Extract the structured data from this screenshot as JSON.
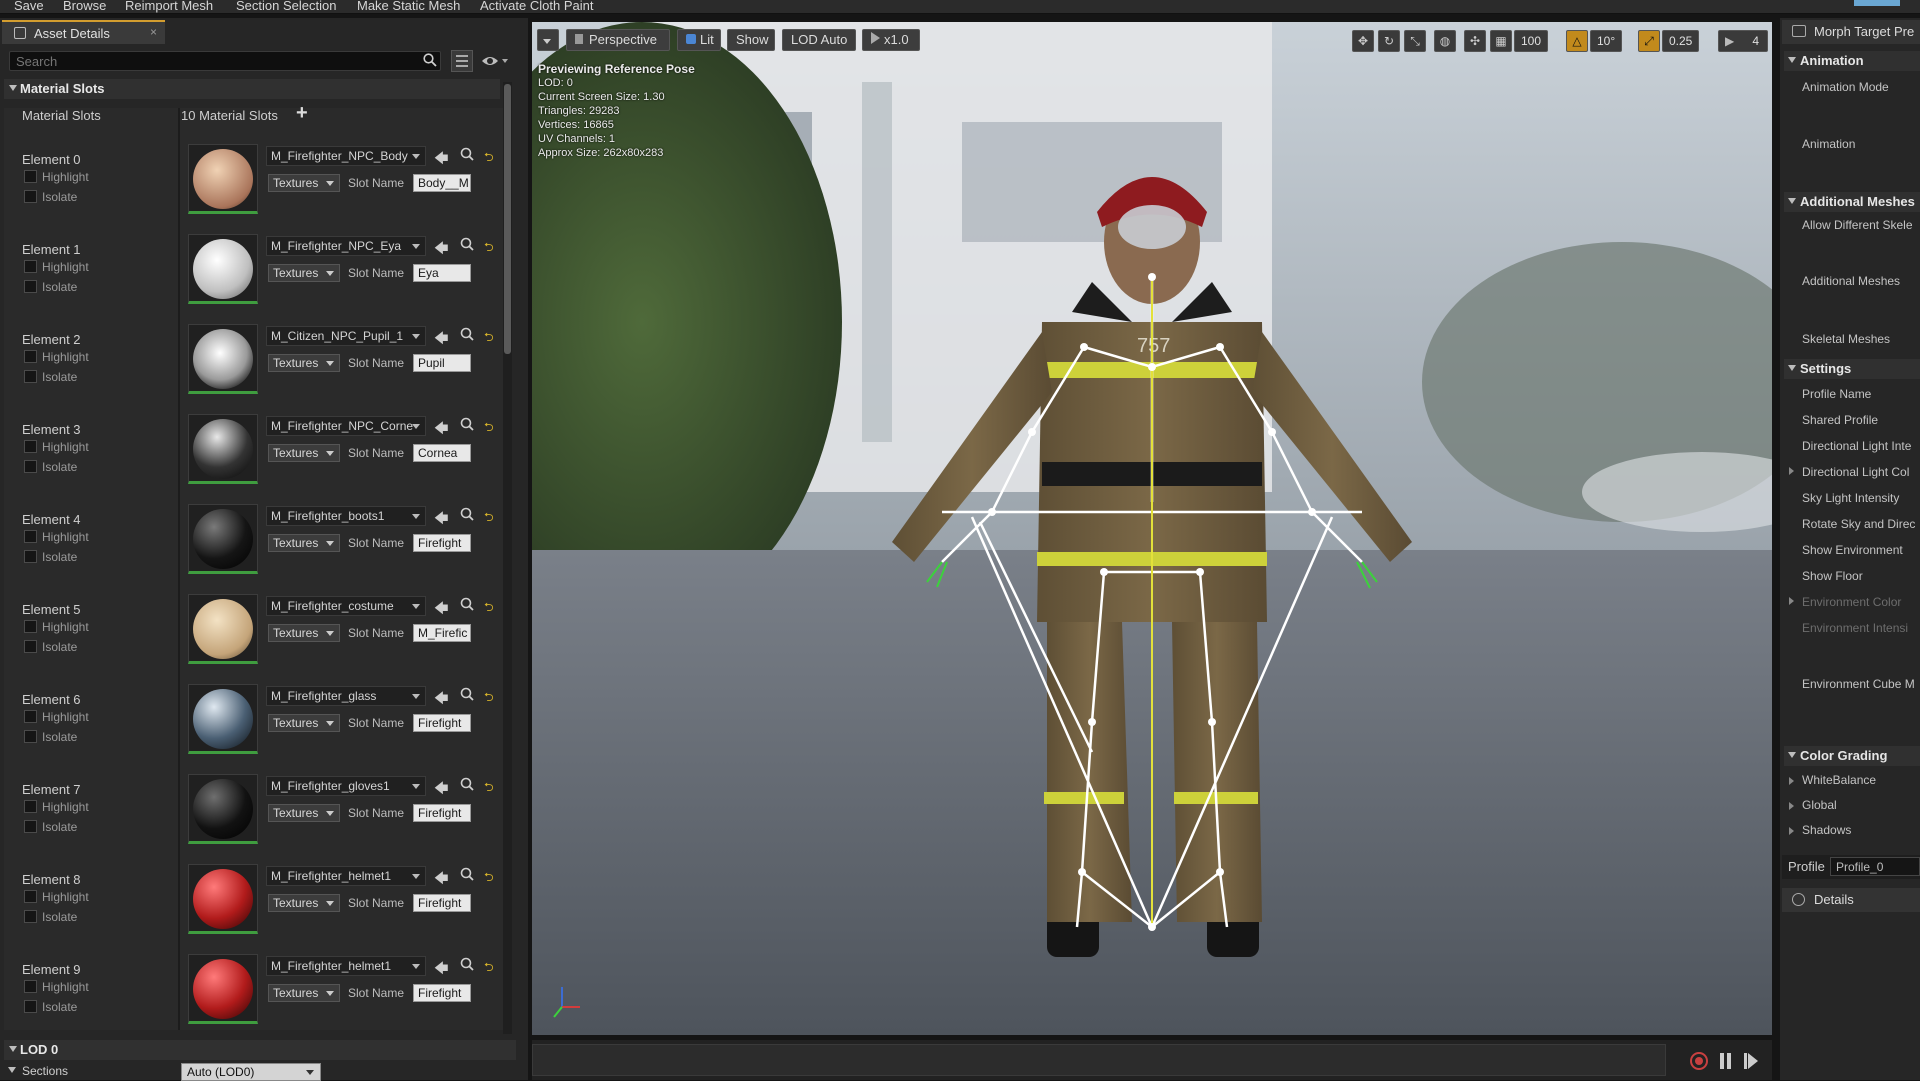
{
  "toolbar": {
    "items": [
      "Save",
      "Browse",
      "Reimport Mesh",
      "Section Selection",
      "Make Static Mesh",
      "Activate Cloth Paint"
    ]
  },
  "left_panel": {
    "tab_title": "Asset Details",
    "search_placeholder": "Search",
    "material_slots_section": "Material Slots",
    "material_slots_label": "Material Slots",
    "material_slots_count": "10 Material Slots",
    "highlight_label": "Highlight",
    "isolate_label": "Isolate",
    "textures_label": "Textures",
    "slot_name_label": "Slot Name",
    "elements": [
      {
        "name": "Element 0",
        "material": "M_Firefighter_NPC_Body",
        "slot": "Body__M"
      },
      {
        "name": "Element 1",
        "material": "M_Firefighter_NPC_Eya",
        "slot": "Eya"
      },
      {
        "name": "Element 2",
        "material": "M_Citizen_NPC_Pupil_1",
        "slot": "Pupil"
      },
      {
        "name": "Element 3",
        "material": "M_Firefighter_NPC_Corne",
        "slot": "Cornea"
      },
      {
        "name": "Element 4",
        "material": "M_Firefighter_boots1",
        "slot": "Firefight"
      },
      {
        "name": "Element 5",
        "material": "M_Firefighter_costume",
        "slot": "M_Firefic"
      },
      {
        "name": "Element 6",
        "material": "M_Firefighter_glass",
        "slot": "Firefight"
      },
      {
        "name": "Element 7",
        "material": "M_Firefighter_gloves1",
        "slot": "Firefight"
      },
      {
        "name": "Element 8",
        "material": "M_Firefighter_helmet1",
        "slot": "Firefight"
      },
      {
        "name": "Element 9",
        "material": "M_Firefighter_helmet1",
        "slot": "Firefight"
      }
    ],
    "lod_section": "LOD 0",
    "sections_label": "Sections",
    "sections_value": "Auto (LOD0)"
  },
  "viewport": {
    "buttons": {
      "perspective": "Perspective",
      "lit": "Lit",
      "show": "Show",
      "lod": "LOD Auto",
      "speed": "x1.0"
    },
    "info_title": "Previewing Reference Pose",
    "info_lines": [
      "LOD: 0",
      "Current Screen Size: 1.30",
      "Triangles: 29283",
      "Vertices: 16865",
      "UV Channels: 1",
      "Approx Size: 262x80x283"
    ],
    "grid_snap": "100",
    "rot_snap": "10°",
    "scale_snap": "0.25",
    "camera_speed": "4",
    "helmet_number": "757"
  },
  "right_panel": {
    "tab_title": "Morph Target Pre",
    "animation_hdr": "Animation",
    "animation_mode": "Animation Mode",
    "animation": "Animation",
    "additional_meshes_hdr": "Additional Meshes",
    "allow_different": "Allow Different Skele",
    "additional_meshes": "Additional Meshes",
    "skeletal_meshes": "Skeletal Meshes",
    "settings_hdr": "Settings",
    "settings_items": [
      "Profile Name",
      "Shared Profile",
      "Directional Light Inte",
      "Directional Light Col",
      "Sky Light Intensity",
      "Rotate Sky and Direc",
      "Show Environment",
      "Show Floor",
      "Environment Color",
      "Environment Intensi",
      "Environment Cube M"
    ],
    "color_grading_hdr": "Color Grading",
    "color_grading_items": [
      "WhiteBalance",
      "Global",
      "Shadows"
    ],
    "profile_label": "Profile",
    "profile_value": "Profile_0",
    "details_tab": "Details"
  },
  "colors": {
    "accent_orange": "#d39d2f",
    "thumb_green": "#3f9d3f",
    "bone_white": "#ffffff",
    "bone_yellow": "#e3e13a"
  }
}
